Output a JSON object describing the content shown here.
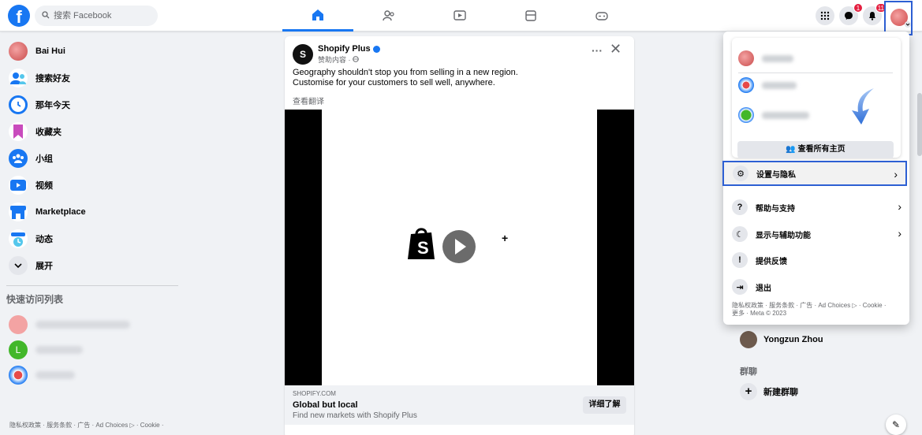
{
  "topbar": {
    "search_placeholder": "搜索 Facebook",
    "nav_tabs": [
      "home",
      "friends",
      "watch",
      "marketplace",
      "gaming"
    ],
    "messenger_badge": "1",
    "notifications_badge": "11"
  },
  "sidebar": {
    "items": [
      {
        "label": "Bai Hui",
        "icon": "profile-avatar"
      },
      {
        "label": "搜索好友",
        "icon": "friends-icon"
      },
      {
        "label": "那年今天",
        "icon": "memories-icon"
      },
      {
        "label": "收藏夹",
        "icon": "saved-icon"
      },
      {
        "label": "小组",
        "icon": "groups-icon"
      },
      {
        "label": "视频",
        "icon": "video-icon"
      },
      {
        "label": "Marketplace",
        "icon": "marketplace-icon"
      },
      {
        "label": "动态",
        "icon": "feeds-icon"
      },
      {
        "label": "展开",
        "icon": "chevron-down-icon"
      }
    ],
    "shortcuts_title": "快速访问列表",
    "footer": "隐私权政策 · 服务条款 · 广告 · Ad Choices ▷ · Cookie ·"
  },
  "post": {
    "author": "Shopify Plus",
    "sponsored": "赞助内容 ·",
    "text_line1": "Geography shouldn't stop you from selling in a new region.",
    "text_line2": "Customise for your customers to sell well, anywhere.",
    "translate": "查看翻译",
    "cta_domain": "SHOPIFY.COM",
    "cta_title": "Global but local",
    "cta_desc": "Find new markets with Shopify Plus",
    "cta_button": "详细了解"
  },
  "right": {
    "contact_name": "Yongzun Zhou",
    "groups_title": "群聊",
    "new_group": "新建群聊"
  },
  "menu": {
    "see_all_profiles": "see all profiles",
    "see_all_profiles_label": "查看所有主页",
    "items": [
      {
        "label": "设置与隐私",
        "icon": "gear-icon"
      },
      {
        "label": "帮助与支持",
        "icon": "help-icon"
      },
      {
        "label": "显示与辅助功能",
        "icon": "moon-icon"
      },
      {
        "label": "提供反馈",
        "icon": "feedback-icon"
      },
      {
        "label": "退出",
        "icon": "logout-icon"
      }
    ],
    "footer_line1": "隐私权政策 · 服务条款 · 广告 · Ad Choices ▷ · Cookie ·",
    "footer_line2": "更多 · Meta © 2023"
  },
  "colors": {
    "brand": "#1877f2",
    "highlight_box": "#2d5fd3",
    "badge": "#e41e3f"
  }
}
